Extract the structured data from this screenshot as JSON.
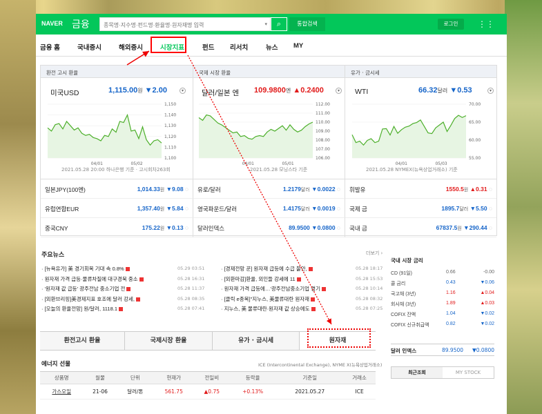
{
  "header": {
    "logo": "NAVER",
    "logo_sub": "금융",
    "search_placeholder": "종목명·지수명·펀드명·환율명·원자재명 입력",
    "search_icon": "magnifier-icon",
    "integrated_search": "통합검색",
    "login": "로그인",
    "apps_icon": "grid-icon"
  },
  "nav": [
    "금융 홈",
    "국내증시",
    "해외증시",
    "시장지표",
    "펀드",
    "리서치",
    "뉴스",
    "MY"
  ],
  "nav_active": "시장지표",
  "panels": [
    {
      "head": "환전 고시 환율",
      "name": "미국USD",
      "value": "1,115.00",
      "unit": "원",
      "change": "▼2.00",
      "dir": "down",
      "src": "2021.05.28 20:00 하나은행 기준 · 고시회차263회",
      "yticks": [
        "1,150",
        "1,140",
        "1,130",
        "1,120",
        "1,110",
        "1,100"
      ],
      "xticks": [
        "04/01",
        "05/02"
      ]
    },
    {
      "head": "국제 시장 환율",
      "name": "달러/일본 엔",
      "value": "109.9800",
      "unit": "엔",
      "change": "▲0.2400",
      "dir": "up",
      "src": "2021.05.28 모닝스타 기준",
      "yticks": [
        "112.00",
        "111.00",
        "110.00",
        "109.00",
        "108.00",
        "107.00",
        "106.00"
      ],
      "xticks": [
        "04/01",
        "05/01"
      ]
    },
    {
      "head": "유가 · 금시세",
      "name": "WTI",
      "value": "66.32",
      "unit": "달러",
      "change": "▼0.53",
      "dir": "down",
      "src": "2021.05.28 NYMEX(뉴욕상업거래소) 기준",
      "yticks": [
        "70.00",
        "65.00",
        "60.00",
        "55.00"
      ],
      "xticks": [
        "04/01",
        "05/03"
      ]
    }
  ],
  "chart_data": [
    {
      "type": "line",
      "series": [
        {
          "values": [
            1128,
            1125,
            1131,
            1132,
            1127,
            1134,
            1130,
            1126,
            1128,
            1123,
            1121,
            1122,
            1119,
            1118,
            1116,
            1121,
            1120,
            1127,
            1124,
            1134,
            1133,
            1140,
            1125,
            1126,
            1118,
            1129,
            1117,
            1112,
            1116,
            1117,
            1114
          ]
        }
      ],
      "ylim": [
        1100,
        1150
      ],
      "xticks": [
        "04/01",
        "05/02"
      ],
      "yticks": [
        "1,150",
        "1,140",
        "1,130",
        "1,120",
        "1,110",
        "1,100"
      ]
    },
    {
      "type": "line",
      "series": [
        {
          "values": [
            110.5,
            110.2,
            110.8,
            110.7,
            110.3,
            109.9,
            109.7,
            109.4,
            109.1,
            108.8,
            108.9,
            108.4,
            108.5,
            108.2,
            108.1,
            108.4,
            108.5,
            108.4,
            108.9,
            109.2,
            109.0,
            109.3,
            109.6,
            109.1,
            109.7,
            109.2,
            108.9,
            109.1,
            109.5,
            109.8,
            110.0
          ]
        }
      ],
      "ylim": [
        106,
        112
      ],
      "xticks": [
        "04/01",
        "05/01"
      ],
      "yticks": [
        "112.00",
        "111.00",
        "110.00",
        "109.00",
        "108.00",
        "107.00",
        "106.00"
      ]
    },
    {
      "type": "line",
      "series": [
        {
          "values": [
            61.5,
            59.3,
            59.7,
            58.6,
            59.9,
            60.4,
            59.3,
            59.7,
            63.1,
            63.2,
            61.4,
            63.8,
            61.9,
            62.9,
            63.6,
            63.9,
            64.6,
            64.9,
            65.6,
            63.8,
            62.0,
            61.8,
            63.4,
            64.2,
            65.0,
            62.4,
            64.1,
            66.0,
            66.9,
            66.3,
            66.8
          ]
        }
      ],
      "ylim": [
        55,
        70
      ],
      "xticks": [
        "04/01",
        "05/03"
      ],
      "yticks": [
        "70.00",
        "65.00",
        "60.00",
        "55.00"
      ]
    }
  ],
  "rows": [
    [
      {
        "name": "일본JPY(100엔)",
        "value": "1,014.33",
        "unit": "원",
        "change": "▼9.08",
        "dir": "down"
      },
      {
        "name": "유로/달러",
        "value": "1.2179",
        "unit": "달러",
        "change": "▼0.0022",
        "dir": "down"
      },
      {
        "name": "휘발유",
        "value": "1550.5",
        "unit": "원",
        "change": "▲0.31",
        "dir": "up"
      }
    ],
    [
      {
        "name": "유럽연합EUR",
        "value": "1,357.40",
        "unit": "원",
        "change": "▼5.84",
        "dir": "down"
      },
      {
        "name": "영국파운드/달러",
        "value": "1.4175",
        "unit": "달러",
        "change": "▼0.0019",
        "dir": "down"
      },
      {
        "name": "국제 금",
        "value": "1895.7",
        "unit": "달러",
        "change": "▼5.50",
        "dir": "down"
      }
    ],
    [
      {
        "name": "중국CNY",
        "value": "175.22",
        "unit": "원",
        "change": "▼0.13",
        "dir": "down"
      },
      {
        "name": "달러인덱스",
        "value": "89.9500",
        "unit": "",
        "change": "▼0.0800",
        "dir": "down"
      },
      {
        "name": "국내 금",
        "value": "67837.5",
        "unit": "원",
        "change": "▼290.44",
        "dir": "down"
      }
    ]
  ],
  "news": {
    "title": "주요뉴스",
    "more": "더보기 ›",
    "left": [
      [
        "[뉴욕유가] 美 경기회복 기대 속 0.8%",
        "05.29 03:51"
      ],
      [
        "원자재 가격 급등·물류차질에 대구경북 중소",
        "05.28 16:31"
      ],
      [
        "'원자재 값 급등' 광주전남 중소기업 전",
        "05.28 11:37"
      ],
      [
        "[외환브리핑]美경제지표 호조에 달러 강세,",
        "05.28 08:35"
      ],
      [
        "[오늘의 환율전망] 원/달러, 1118.1",
        "05.28 07:41"
      ]
    ],
    "right": [
      [
        "[경제전망 꾼] 원자재 급등에 수급 불안,",
        "05.28 18:17"
      ],
      [
        "[외환마감]환율, 외인들 강세에 11",
        "05.28 15:53"
      ],
      [
        "원자재 가격 급등에…'광주전남중소기업 경기",
        "05.28 10:14"
      ],
      [
        "[클릭 e종목]\"지누스, 美물류대란 원자재",
        "05.28 08:32"
      ],
      [
        "지누스, 美 물류대란·원자재 값 상승에도",
        "05.28 07:25"
      ]
    ]
  },
  "tabs": [
    "환전고시 환율",
    "국제시장 환율",
    "유가 · 금시세",
    "원자재"
  ],
  "energy": {
    "title": "에너지 선물",
    "src": "ICE (Intercontinental Exchange), NYME X(뉴욕상업거래소)",
    "headers": [
      "상품명",
      "월물",
      "단위",
      "현재가",
      "전일비",
      "등락율",
      "기준일",
      "거래소"
    ],
    "row": [
      "가스오일",
      "21-06",
      "달러/톤",
      "561.75",
      "▲0.75",
      "+0.13%",
      "2021.05.27",
      "ICE"
    ]
  },
  "side": {
    "title": "국내 시장 금리",
    "rows": [
      [
        "CD (91일)",
        "0.66",
        "-0.00",
        "flat"
      ],
      [
        "콜 금리",
        "0.43",
        "▼0.06",
        "down"
      ],
      [
        "국고채 (3년)",
        "1.16",
        "▲0.04",
        "up"
      ],
      [
        "회사채 (3년)",
        "1.89",
        "▲0.03",
        "up"
      ],
      [
        "COFIX 잔액",
        "1.04",
        "▼0.02",
        "down"
      ],
      [
        "COFIX 신규취급액",
        "0.82",
        "▼0.02",
        "down"
      ]
    ],
    "dollar_label": "달러 인덱스",
    "dollar_value": "89.9500",
    "dollar_change": "▼0.0800",
    "tabs": [
      "최근조회",
      "MY STOCK"
    ]
  },
  "colors": {
    "brand": "#03c75a",
    "up": "#e11a1a",
    "down": "#1665c9",
    "annotation": "#ff0000"
  }
}
